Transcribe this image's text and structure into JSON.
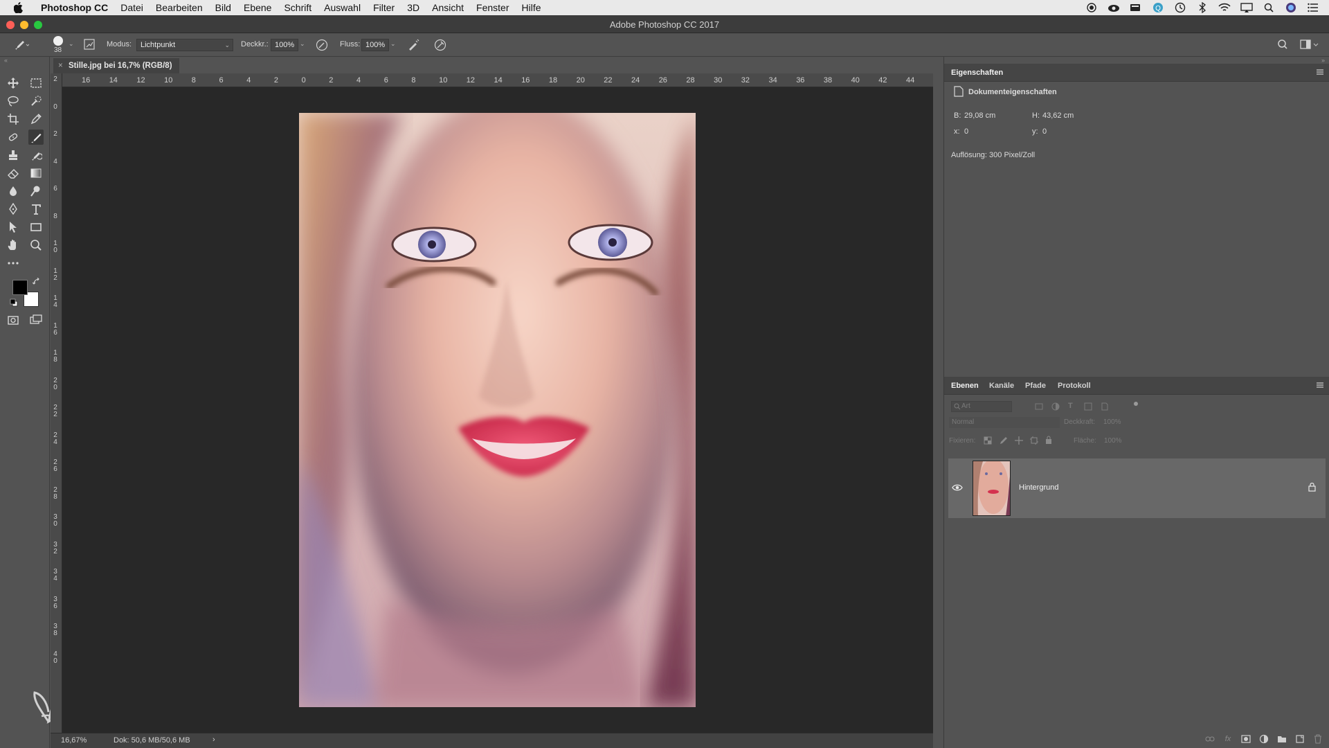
{
  "menubar": {
    "app_name": "Photoshop CC",
    "items": [
      "Datei",
      "Bearbeiten",
      "Bild",
      "Ebene",
      "Schrift",
      "Auswahl",
      "Filter",
      "3D",
      "Ansicht",
      "Fenster",
      "Hilfe"
    ]
  },
  "window": {
    "title": "Adobe Photoshop CC 2017"
  },
  "options": {
    "brush_size": "38",
    "mode_label": "Modus:",
    "mode_value": "Lichtpunkt",
    "opacity_label": "Deckkr.:",
    "opacity_value": "100%",
    "flow_label": "Fluss:",
    "flow_value": "100%"
  },
  "document": {
    "tab_title": "Stille.jpg bei 16,7% (RGB/8)",
    "close": "×",
    "zoom": "16,67%",
    "doc_size": "Dok: 50,6 MB/50,6 MB",
    "status_arrow": "›"
  },
  "ruler": {
    "top": [
      "16",
      "14",
      "12",
      "10",
      "8",
      "6",
      "4",
      "2",
      "0",
      "2",
      "4",
      "6",
      "8",
      "10",
      "12",
      "14",
      "16",
      "18",
      "20",
      "22",
      "24",
      "26",
      "28",
      "30",
      "32",
      "34",
      "36",
      "38",
      "40",
      "42",
      "44"
    ],
    "left": [
      "2",
      "0",
      "2",
      "4",
      "6",
      "8",
      "1\n0",
      "1\n2",
      "1\n4",
      "1\n6",
      "1\n8",
      "2\n0",
      "2\n2",
      "2\n4",
      "2\n6",
      "2\n8",
      "3\n0",
      "3\n2",
      "3\n4",
      "3\n6",
      "3\n8",
      "4\n0"
    ]
  },
  "properties": {
    "tab": "Eigenschaften",
    "section": "Dokumenteigenschaften",
    "width_label": "B:",
    "width_value": "29,08 cm",
    "height_label": "H:",
    "height_value": "43,62 cm",
    "x_label": "x:",
    "x_value": "0",
    "y_label": "y:",
    "y_value": "0",
    "resolution": "Auflösung: 300 Pixel/Zoll"
  },
  "layers": {
    "tabs": [
      "Ebenen",
      "Kanäle",
      "Pfade",
      "Protokoll"
    ],
    "filter_placeholder": "Art",
    "blend_mode": "Normal",
    "opacity_label": "Deckkraft:",
    "opacity_value": "100%",
    "lock_label": "Fixieren:",
    "fill_label": "Fläche:",
    "fill_value": "100%",
    "layer_name": "Hintergrund"
  },
  "colors": {
    "accent_lips": "#d4334f",
    "panel_bg": "#535353",
    "canvas_bg": "#282828"
  }
}
